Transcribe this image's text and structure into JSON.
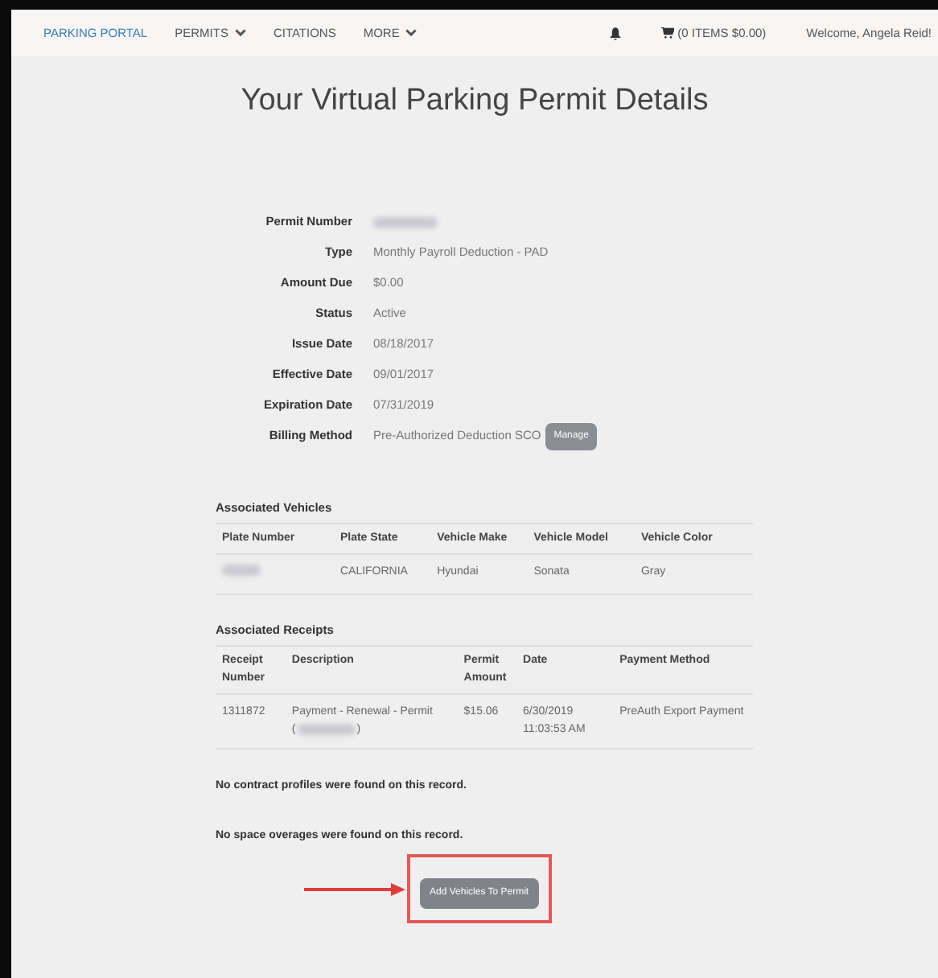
{
  "nav": {
    "brand": "PARKING PORTAL",
    "items": [
      {
        "label": "PERMITS",
        "dropdown": true
      },
      {
        "label": "CITATIONS",
        "dropdown": false
      },
      {
        "label": "MORE",
        "dropdown": true
      }
    ],
    "cart": "(0 ITEMS $0.00)",
    "welcome": "Welcome, Angela Reid!"
  },
  "title": "Your Virtual Parking Permit Details",
  "details": [
    {
      "label": "Permit Number",
      "kind": "redacted"
    },
    {
      "label": "Type",
      "kind": "text",
      "value": "Monthly Payroll Deduction - PAD"
    },
    {
      "label": "Amount Due",
      "kind": "text",
      "value": "$0.00"
    },
    {
      "label": "Status",
      "kind": "text",
      "value": "Active"
    },
    {
      "label": "Issue Date",
      "kind": "text",
      "value": "08/18/2017"
    },
    {
      "label": "Effective Date",
      "kind": "text",
      "value": "09/01/2017"
    },
    {
      "label": "Expiration Date",
      "kind": "text",
      "value": "07/31/2019"
    },
    {
      "label": "Billing Method",
      "kind": "button",
      "value": "Pre-Authorized Deduction SCO",
      "button": "Manage"
    }
  ],
  "vehicles": {
    "heading": "Associated Vehicles",
    "columns": [
      "Plate Number",
      "Plate State",
      "Vehicle Make",
      "Vehicle Model",
      "Vehicle Color"
    ],
    "rows": [
      [
        "",
        "CALIFORNIA",
        "Hyundai",
        "Sonata",
        "Gray"
      ]
    ]
  },
  "receipts": {
    "heading": "Associated Receipts",
    "columns": [
      "Receipt Number",
      "Description",
      "Permit Amount",
      "Date",
      "Payment Method"
    ],
    "rows": [
      [
        "1311872",
        "Payment - Renewal - Permit",
        "$15.06",
        "6/30/2019 11:03:53 AM",
        "PreAuth Export Payment"
      ]
    ],
    "reference": {
      "open": "(",
      "close": ")"
    }
  },
  "notes": [
    "No contract profiles were found on this record.",
    "No space overages were found on this record."
  ],
  "action": "Add Vehicles To Permit"
}
